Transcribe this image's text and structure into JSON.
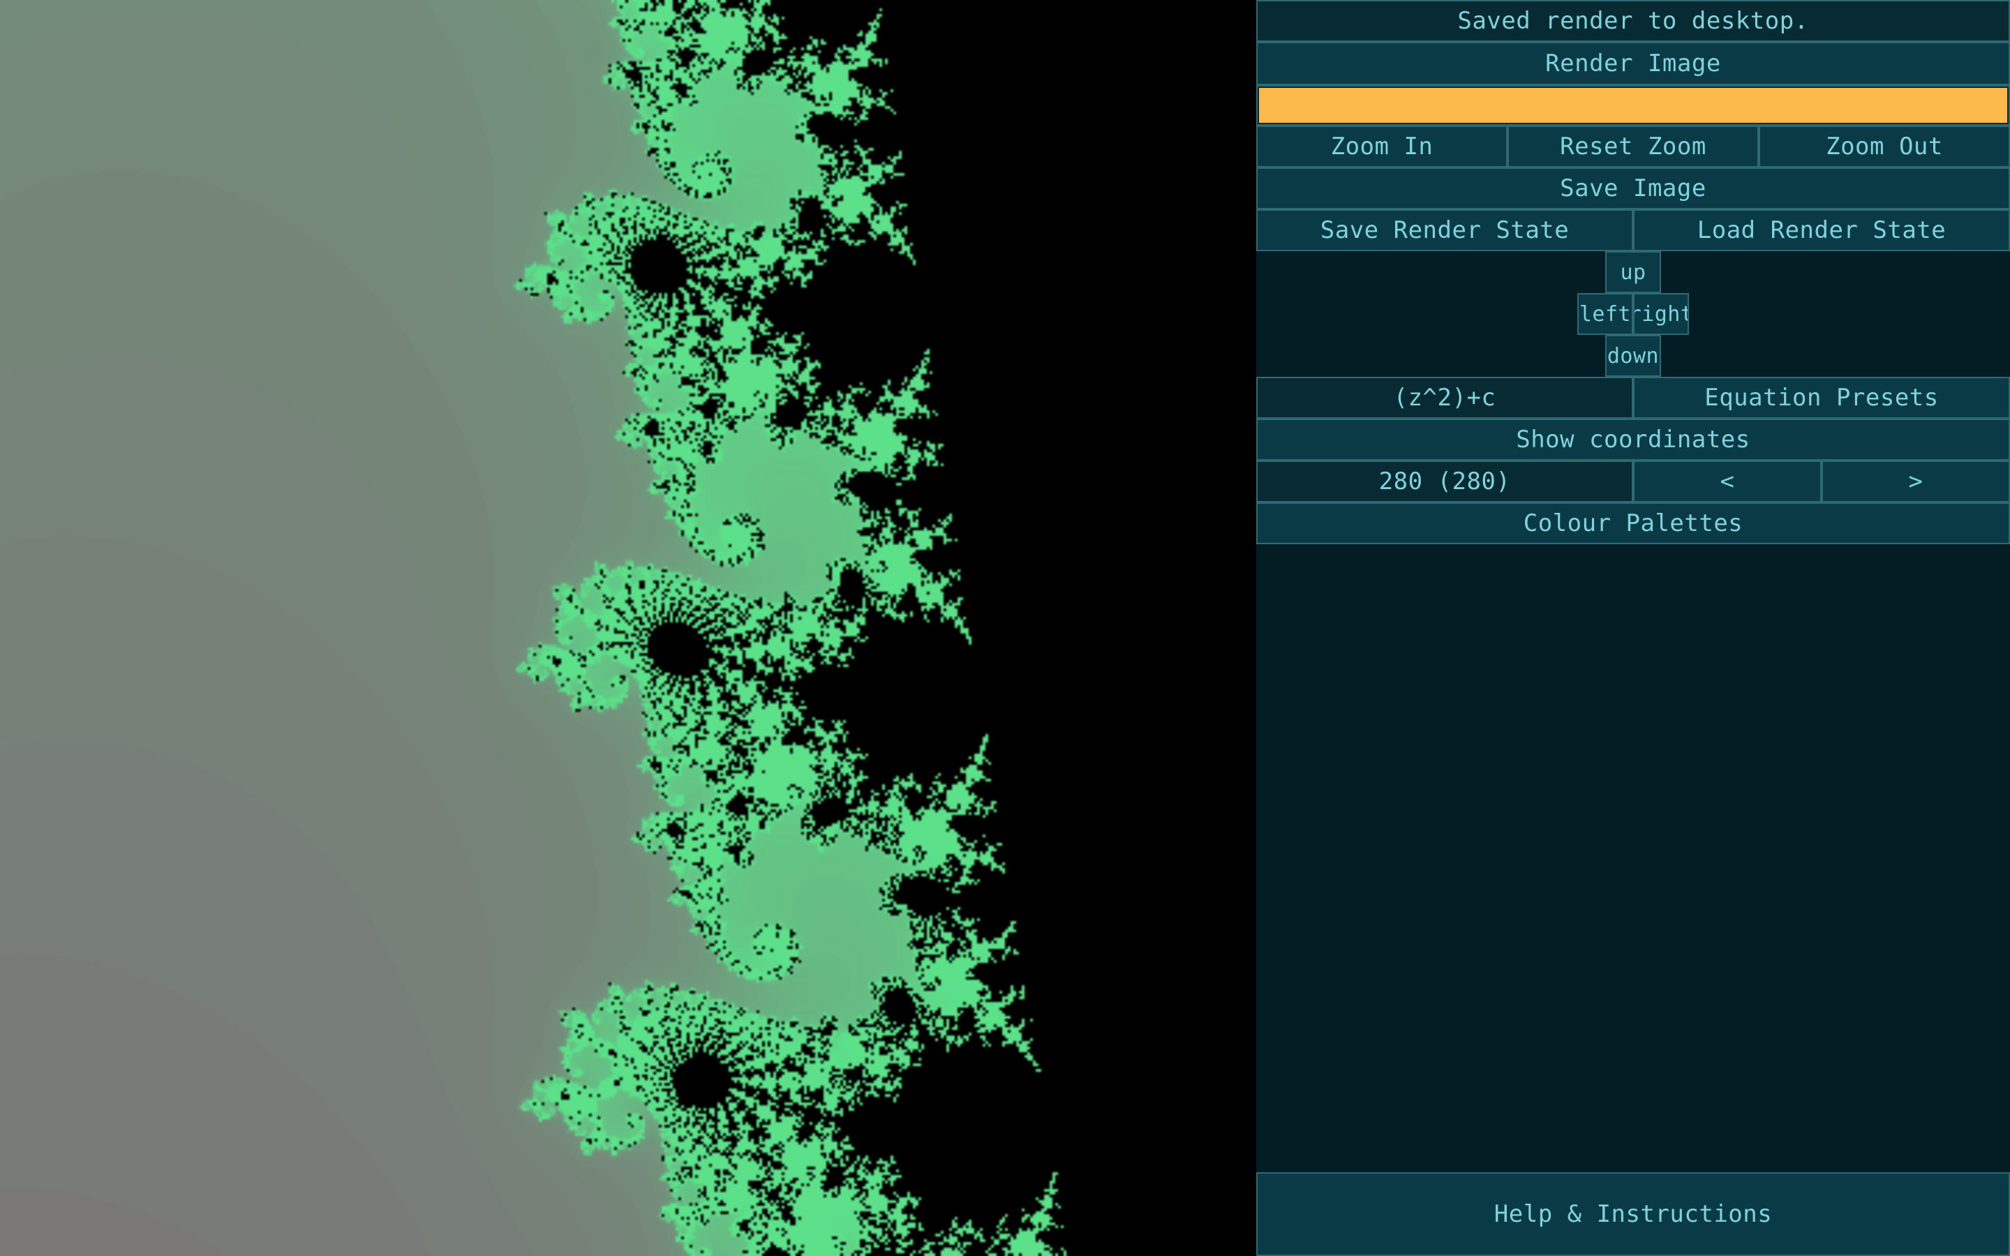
{
  "status": {
    "message": "Saved render to desktop."
  },
  "render": {
    "label": "Render Image",
    "progress": 1.0,
    "progress_color": "#fbb84b"
  },
  "zoom": {
    "zoom_in": "Zoom In",
    "reset": "Reset Zoom",
    "zoom_out": "Zoom Out"
  },
  "save_image": {
    "label": "Save Image"
  },
  "state": {
    "save": "Save Render State",
    "load": "Load Render State"
  },
  "pan": {
    "up": "up",
    "left": "left",
    "right": "right",
    "down": "down"
  },
  "equation": {
    "current": "(z^2)+c",
    "presets": "Equation Presets"
  },
  "coordinates": {
    "label": "Show coordinates"
  },
  "iterations": {
    "value": "280 (280)",
    "prev": "<",
    "next": ">"
  },
  "palettes": {
    "label": "Colour Palettes"
  },
  "help": {
    "label": "Help & Instructions"
  },
  "colors": {
    "panel_bg": "#041d24",
    "button_bg": "#0a3a46",
    "button_border": "#2e6a74",
    "text": "#7ed3dc",
    "fractal_interior": "#000000",
    "fractal_outer": "#e7c46c",
    "fractal_mid": "#8b3a6b",
    "fractal_edge": "#5ce08a"
  }
}
